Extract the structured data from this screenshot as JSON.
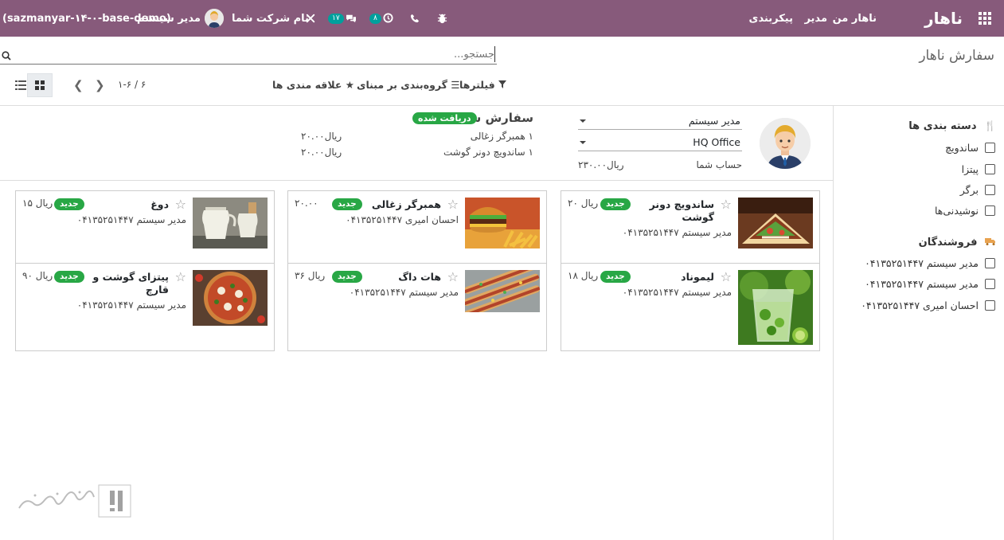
{
  "nav": {
    "brand": "ناهار",
    "menu": [
      "ناهار من",
      "مدیر",
      "پیکربندی"
    ],
    "chat_count": "۱۷",
    "activity_count": "۸",
    "company": "نام شرکت شما",
    "user": "مدیر سیستم",
    "db": "(sazmanyar-۱۴-۰-base-demo)"
  },
  "control": {
    "title": "سفارش ناهار",
    "search_placeholder": "جستجو...",
    "filters": "فیلترها",
    "groupby": "گروه‌بندی بر مبنای",
    "favorites": "علاقه مندی ها",
    "pager": "۱-۶ / ۶"
  },
  "sidebar": {
    "categories_title": "دسته بندی ها",
    "categories": [
      "ساندویچ",
      "پیتزا",
      "برگر",
      "نوشیدنی‌ها"
    ],
    "vendors_title": "فروشندگان",
    "vendors": [
      "مدیر سیستم ۰۴۱۳۵۲۵۱۴۴۷",
      "مدیر سیستم ۰۴۱۳۵۲۵۱۴۴۷",
      "احسان امیری ۰۴۱۳۵۲۵۱۴۴۷"
    ]
  },
  "order": {
    "user": "مدیر سیستم",
    "location": "HQ Office",
    "account_label": "حساب شما",
    "account_value": "۲۳۰.۰۰ریال",
    "title": "سفارش شما",
    "status": "دریافت شده",
    "lines": [
      {
        "text": "۱  همبرگر زغالی",
        "price": "۲۰.۰۰ریال"
      },
      {
        "text": "۱  ساندویچ دونر گوشت",
        "price": "۲۰.۰۰ریال"
      }
    ]
  },
  "products": [
    {
      "name": "ساندویچ دونر گوشت",
      "badge": "جدید",
      "price": "۲۰ ریال",
      "vendor": "مدیر سیستم ۰۴۱۳۵۲۵۱۴۴۷"
    },
    {
      "name": "همبرگر زغالی",
      "badge": "جدید",
      "price": "۲۰.۰۰",
      "vendor": "احسان امیری ۰۴۱۳۵۲۵۱۴۴۷"
    },
    {
      "name": "دوغ",
      "badge": "جدید",
      "price": "۱۵ ریال",
      "vendor": "مدیر سیستم ۰۴۱۳۵۲۵۱۴۴۷"
    },
    {
      "name": "لیموناد",
      "badge": "جدید",
      "price": "۱۸ ریال",
      "vendor": "مدیر سیستم ۰۴۱۳۵۲۵۱۴۴۷"
    },
    {
      "name": "هات داگ",
      "badge": "جدید",
      "price": "۳۶ ریال",
      "vendor": "مدیر سیستم ۰۴۱۳۵۲۵۱۴۴۷"
    },
    {
      "name": "پیتزای گوشت و قارچ",
      "badge": "جدید",
      "price": "۹۰ ریال",
      "vendor": "مدیر سیستم ۰۴۱۳۵۲۵۱۴۴۷"
    }
  ],
  "watermark": "تسهیل‌گستر"
}
